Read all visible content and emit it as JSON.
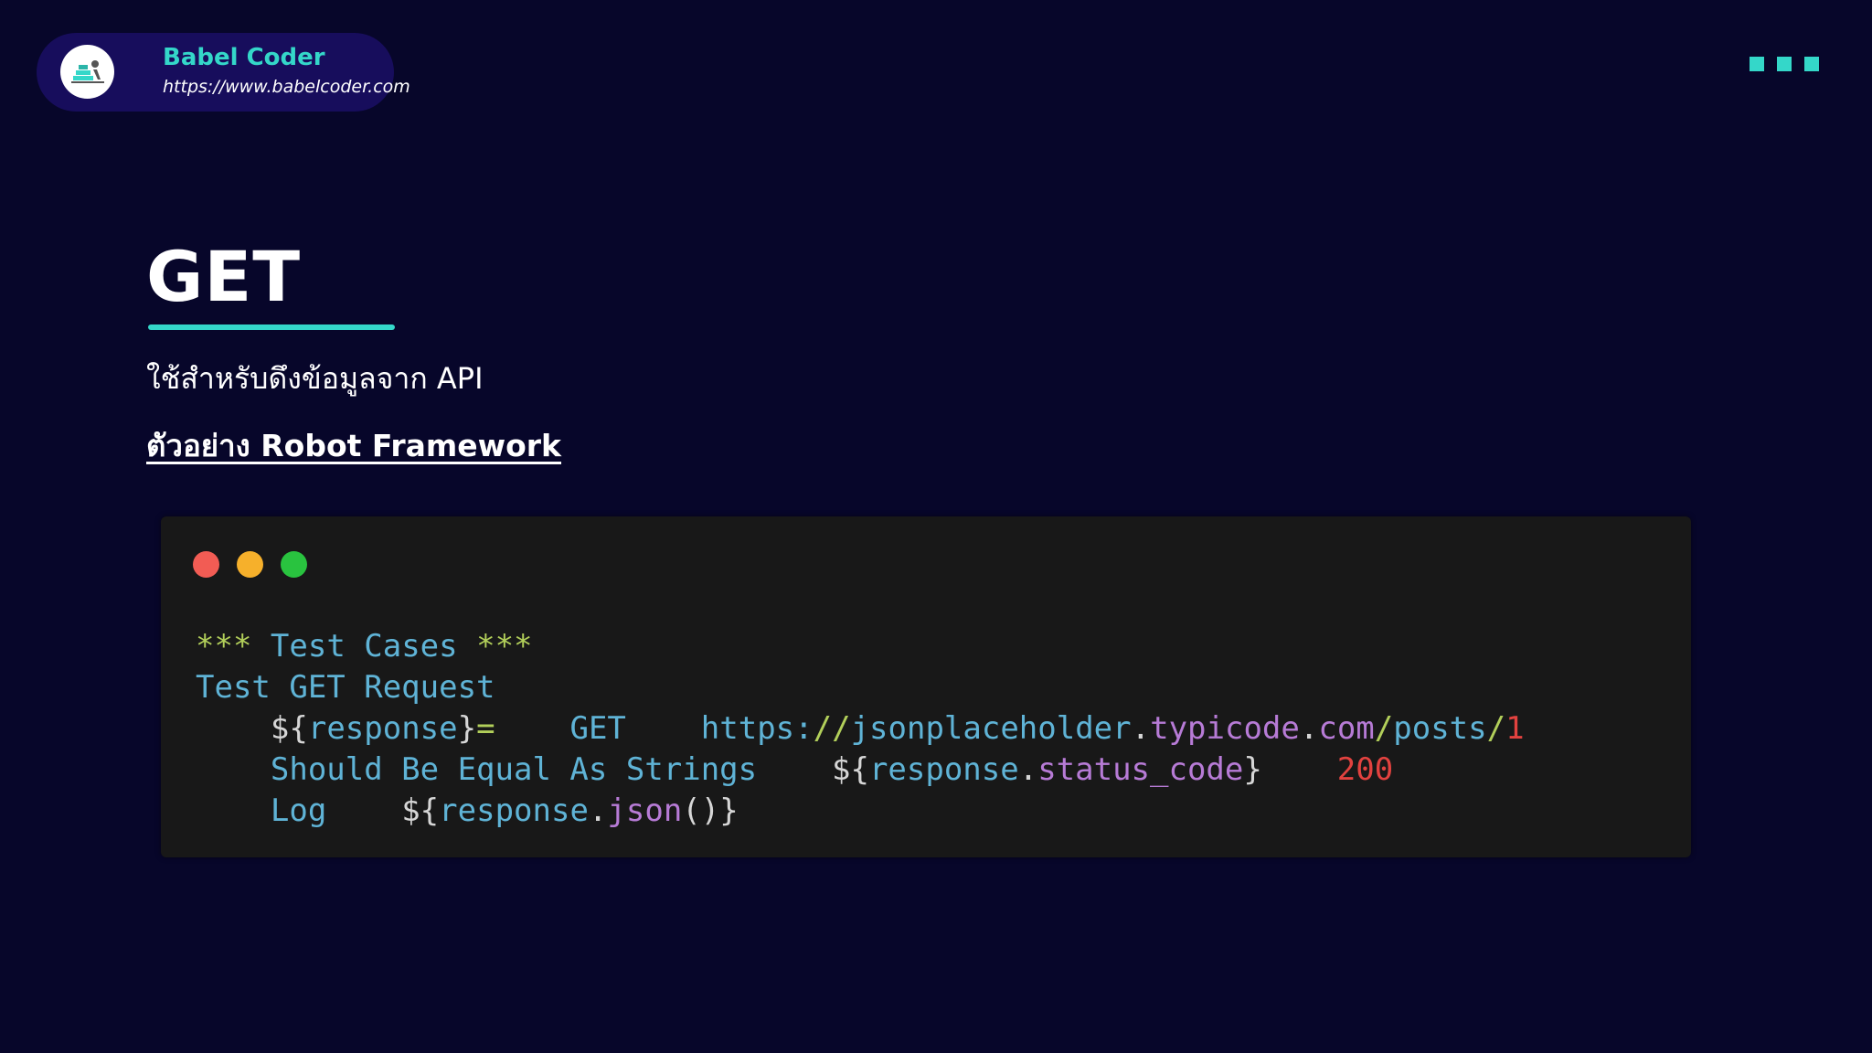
{
  "brand": {
    "name": "Babel Coder",
    "url": "https://www.babelcoder.com",
    "accent": "#34d7c9"
  },
  "menu": {
    "icon": "three-squares-icon"
  },
  "slide": {
    "title": "GET",
    "subtitle": "ใช้สำหรับดึงข้อมูลจาก API",
    "example_label": "ตัวอย่าง Robot Framework"
  },
  "code_window": {
    "traffic_lights": [
      "#f25c54",
      "#f6b02b",
      "#29c33f"
    ],
    "lines": [
      {
        "tokens": [
          {
            "t": "***",
            "c": "c-star"
          },
          {
            "t": " ",
            "c": "c-punc"
          },
          {
            "t": "Test Cases",
            "c": "c-kw"
          },
          {
            "t": " ",
            "c": "c-punc"
          },
          {
            "t": "***",
            "c": "c-star"
          }
        ]
      },
      {
        "tokens": [
          {
            "t": "Test GET Request",
            "c": "c-kw"
          }
        ]
      },
      {
        "tokens": [
          {
            "t": "    ",
            "c": "c-punc"
          },
          {
            "t": "${",
            "c": "c-punc"
          },
          {
            "t": "response",
            "c": "c-var"
          },
          {
            "t": "}",
            "c": "c-punc"
          },
          {
            "t": "=",
            "c": "c-eq"
          },
          {
            "t": "    ",
            "c": "c-punc"
          },
          {
            "t": "GET",
            "c": "c-kw"
          },
          {
            "t": "    ",
            "c": "c-punc"
          },
          {
            "t": "https:",
            "c": "c-url"
          },
          {
            "t": "//",
            "c": "c-slash"
          },
          {
            "t": "jsonplaceholder",
            "c": "c-url"
          },
          {
            "t": ".",
            "c": "c-punc"
          },
          {
            "t": "typicode",
            "c": "c-prop"
          },
          {
            "t": ".",
            "c": "c-punc"
          },
          {
            "t": "com",
            "c": "c-prop"
          },
          {
            "t": "/",
            "c": "c-slash"
          },
          {
            "t": "posts",
            "c": "c-url"
          },
          {
            "t": "/",
            "c": "c-slash"
          },
          {
            "t": "1",
            "c": "c-num"
          }
        ]
      },
      {
        "tokens": [
          {
            "t": "    ",
            "c": "c-punc"
          },
          {
            "t": "Should Be Equal As Strings",
            "c": "c-kw"
          },
          {
            "t": "    ",
            "c": "c-punc"
          },
          {
            "t": "${",
            "c": "c-punc"
          },
          {
            "t": "response",
            "c": "c-var"
          },
          {
            "t": ".",
            "c": "c-punc"
          },
          {
            "t": "status_code",
            "c": "c-prop"
          },
          {
            "t": "}",
            "c": "c-punc"
          },
          {
            "t": "    ",
            "c": "c-punc"
          },
          {
            "t": "200",
            "c": "c-num"
          }
        ]
      },
      {
        "tokens": [
          {
            "t": "    ",
            "c": "c-punc"
          },
          {
            "t": "Log",
            "c": "c-kw"
          },
          {
            "t": "    ",
            "c": "c-punc"
          },
          {
            "t": "${",
            "c": "c-punc"
          },
          {
            "t": "response",
            "c": "c-var"
          },
          {
            "t": ".",
            "c": "c-punc"
          },
          {
            "t": "json",
            "c": "c-prop"
          },
          {
            "t": "()",
            "c": "c-punc"
          },
          {
            "t": "}",
            "c": "c-punc"
          }
        ]
      }
    ]
  }
}
